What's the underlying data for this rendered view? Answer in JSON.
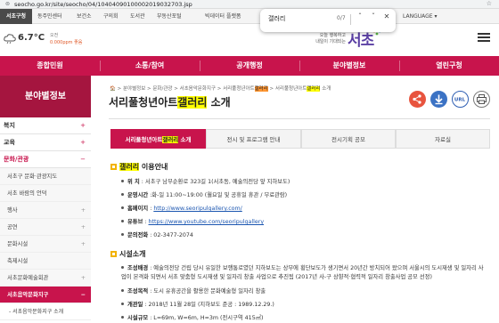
{
  "browser": {
    "url": "seocho.go.kr/site/seocho/04/10404090100002019032703.jsp"
  },
  "govbar": {
    "items": [
      "서초구청",
      "동주민센터",
      "보건소",
      "구의회",
      "도서관",
      "부동산포털",
      "빅데이터 플랫폼"
    ],
    "language": "LANGUAGE"
  },
  "findbar": {
    "query": "갤러리",
    "count": "0/7"
  },
  "header": {
    "temperature": "6.7°C",
    "time": "오전",
    "dust": "0.000ppm 좋음",
    "slogan_line1": "오늘 행복하고",
    "slogan_line2": "내일이 기대되는",
    "logo": "서초"
  },
  "gnb": {
    "items": [
      "종합민원",
      "소통/참여",
      "공개행정",
      "분야별정보",
      "열린구청"
    ]
  },
  "sidebar": {
    "title": "분야별정보",
    "items": [
      {
        "label": "복지",
        "sym": "+"
      },
      {
        "label": "교육",
        "sym": "+"
      },
      {
        "label": "문화/관광",
        "sym": "−"
      }
    ],
    "sub": [
      {
        "label": "서초구 문화·관광지도",
        "sym": ""
      },
      {
        "label": "서초 바람의 언덕",
        "sym": ""
      },
      {
        "label": "행사",
        "sym": "+"
      },
      {
        "label": "공연",
        "sym": "+"
      },
      {
        "label": "문화시설",
        "sym": "+"
      },
      {
        "label": "축제시설",
        "sym": ""
      },
      {
        "label": "서초문화예술회관",
        "sym": "+"
      },
      {
        "label": "서초음악문화지구",
        "sym": "−"
      }
    ],
    "child": "- 서초음악문화지구 소개"
  },
  "main": {
    "breadcrumb_pre": "🏠 > 분야별정보 > 문화/관광 > 서초음악문화지구 > 서리풀청년아트",
    "breadcrumb_hl1": "갤러리",
    "breadcrumb_mid": " > 서리풀청년아트",
    "breadcrumb_hl2": "갤러리",
    "breadcrumb_post": " 소개",
    "title_pre": "서리풀청년아트",
    "title_hl": "갤러리",
    "title_post": " 소개",
    "action_icons": [
      "share-icon",
      "download-icon",
      "url-icon",
      "print-icon"
    ],
    "url_label": "URL",
    "tabs": {
      "t1_pre": "서리풀청년아트",
      "t1_hl": "갤러리",
      "t1_post": " 소개",
      "t2": "전시 및 프로그램 안내",
      "t3": "전시기획 공모",
      "t4": "자료실"
    },
    "section1": {
      "title_hl": "갤러리",
      "title_post": " 이용안내",
      "rows": [
        {
          "label": "위 치",
          "value": " : 서초구 남부순환로 323길 1(서초동, 예술의전당 앞 지하보도)"
        },
        {
          "label": "운영시간",
          "value": " :화-일 11:00~19:00 (월요일 및 공휴일 휴관 / 무료관람)"
        },
        {
          "label": "홈페이지",
          "value": " : ",
          "link": "http://www.seoripulgallery.com/"
        },
        {
          "label": "유튜브",
          "value": " : ",
          "link": "https://www.youtube.com/seoripulgallery"
        },
        {
          "label": "문의전화",
          "value": " : 02-3477-2074"
        }
      ]
    },
    "section2": {
      "title": "시설소개",
      "p1_label": "조성배경",
      "p1_text": " : 예술의전당 건립 당시 유일한 보행통로였던 지하보도는 상부에 횡단보도가 생기면서 20년간 방치되어 왔으며 서울시의 도시재생 및 일자리 사업이 본격화 되면서 서초 맞춤형 도시재생 및 일자리 창출 사업으로 추진됨 (2017년 사-구 상향적·협력적 일자리 창출사업 공모 선정)",
      "p2_label": "조성목적",
      "p2_text": " : 도시 유휴공간을 활용한 문화예술형 일자리 창출",
      "p3_label": "개관일",
      "p3_text": " : 2018년 11월 28일 (지하보도 준공 : 1989.12.29.)",
      "p4_label": "시설규모",
      "p4_text": " : L=69m, W=6m, H=3m (전시구역 415㎡)"
    }
  }
}
